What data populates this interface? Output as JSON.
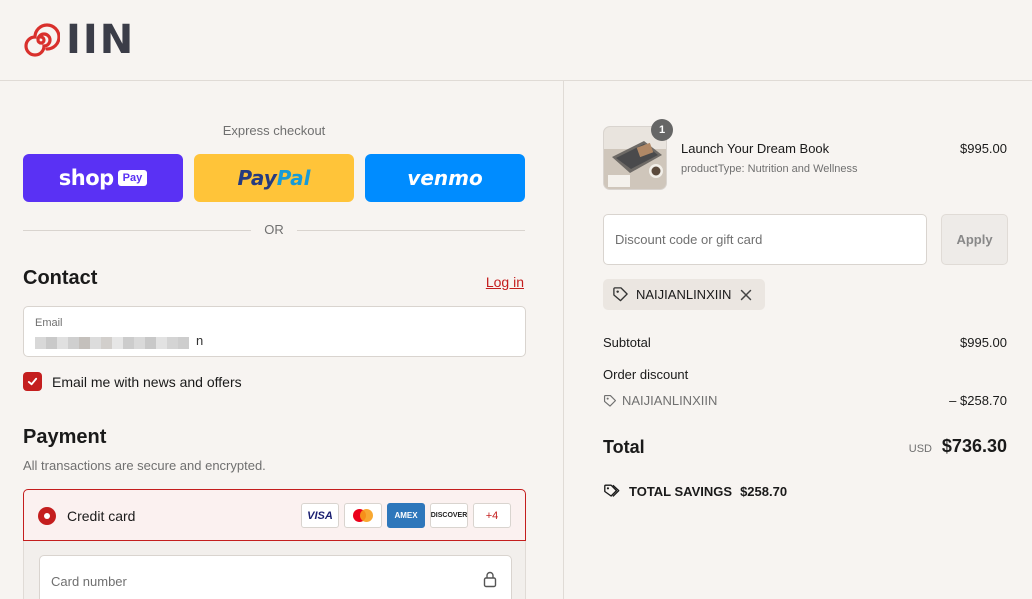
{
  "header": {
    "logo_text": "IIN"
  },
  "express": {
    "title": "Express checkout",
    "shop_label": "shop",
    "shop_badge": "Pay",
    "paypal_part1": "Pay",
    "paypal_part2": "Pal",
    "venmo_label": "venmo",
    "or_text": "OR"
  },
  "contact": {
    "title": "Contact",
    "login_label": "Log in",
    "email_label": "Email",
    "email_tail": "n",
    "newsletter_label": "Email me with news and offers",
    "newsletter_checked": true
  },
  "payment": {
    "title": "Payment",
    "subtitle": "All transactions are secure and encrypted.",
    "method_label": "Credit card",
    "cards": [
      "VISA",
      "",
      "AMEX",
      "DISCOVER"
    ],
    "more_cards": "+4",
    "card_number_placeholder": "Card number"
  },
  "summary": {
    "product": {
      "name": "Launch Your Dream Book",
      "type": "productType: Nutrition and Wellness",
      "price": "$995.00",
      "quantity": "1"
    },
    "discount_placeholder": "Discount code or gift card",
    "apply_label": "Apply",
    "applied_code": "NAIJIANLINXIIN",
    "subtotal_label": "Subtotal",
    "subtotal_value": "$995.00",
    "order_discount_label": "Order discount",
    "discount_code": "NAIJIANLINXIIN",
    "discount_value": "– $258.70",
    "total_label": "Total",
    "currency": "USD",
    "total_value": "$736.30",
    "savings_label": "TOTAL SAVINGS",
    "savings_value": "$258.70"
  },
  "colors": {
    "accent": "#c41e1e",
    "shop_pay": "#5a31f4",
    "paypal": "#ffc439",
    "venmo": "#008cff",
    "background": "#f7f4f1"
  }
}
